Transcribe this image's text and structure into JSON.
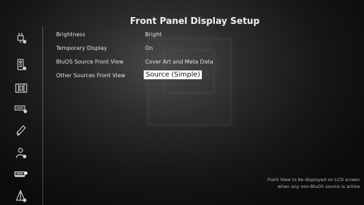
{
  "title": "Front Panel Display Setup",
  "sidebar": {
    "items": [
      {
        "icon": "input-plug-icon"
      },
      {
        "icon": "remote-control-icon"
      },
      {
        "icon": "speaker-icon"
      },
      {
        "icon": "audio-settings-icon"
      },
      {
        "icon": "pen-icon"
      },
      {
        "icon": "user-settings-icon"
      },
      {
        "icon": "display-settings-icon",
        "active": true
      },
      {
        "icon": "network-icon"
      }
    ]
  },
  "settings": [
    {
      "label": "Brightness",
      "value": "Bright"
    },
    {
      "label": "Temporary Display",
      "value": "On"
    },
    {
      "label": "BluOS Source Front View",
      "value": "Cover Art and Meta Data"
    },
    {
      "label": "Other Sources Front View",
      "value": "Source (Simple)",
      "selected": true
    }
  ],
  "help": {
    "line1": "Front View to be displayed on LCD screen",
    "line2": "when any non-BluOS source is active"
  }
}
